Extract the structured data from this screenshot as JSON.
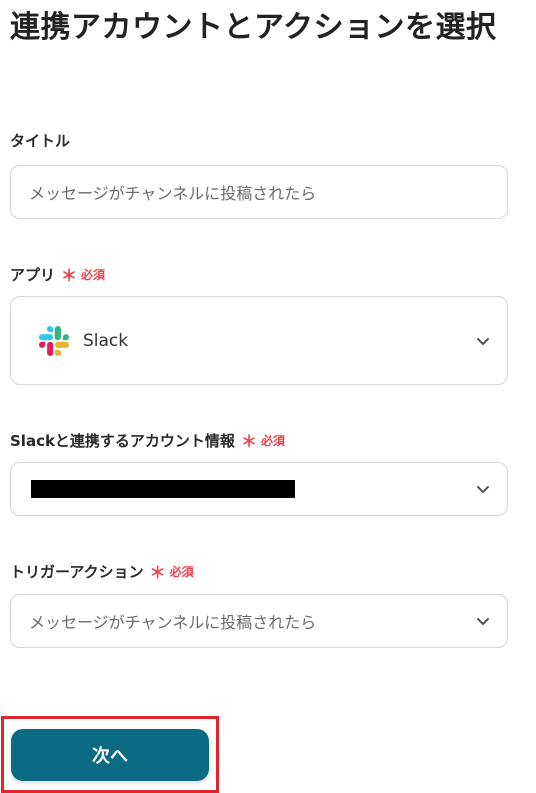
{
  "header": {
    "title": "連携アカウントとアクションを選択"
  },
  "form": {
    "title_field": {
      "label": "タイトル",
      "value": "メッセージがチャンネルに投稿されたら"
    },
    "app_field": {
      "label": "アプリ",
      "required_mark": "＊",
      "required_text": "必須",
      "value": "Slack",
      "icon": "slack-icon"
    },
    "account_field": {
      "label": "Slackと連携するアカウント情報",
      "required_mark": "＊",
      "required_text": "必須",
      "value_redacted": true
    },
    "trigger_field": {
      "label": "トリガーアクション",
      "required_mark": "＊",
      "required_text": "必須",
      "value": "メッセージがチャンネルに投稿されたら"
    }
  },
  "actions": {
    "next_label": "次へ"
  },
  "colors": {
    "primary_button": "#0c6b84",
    "required": "#e8444e",
    "highlight_border": "#e0262d"
  }
}
